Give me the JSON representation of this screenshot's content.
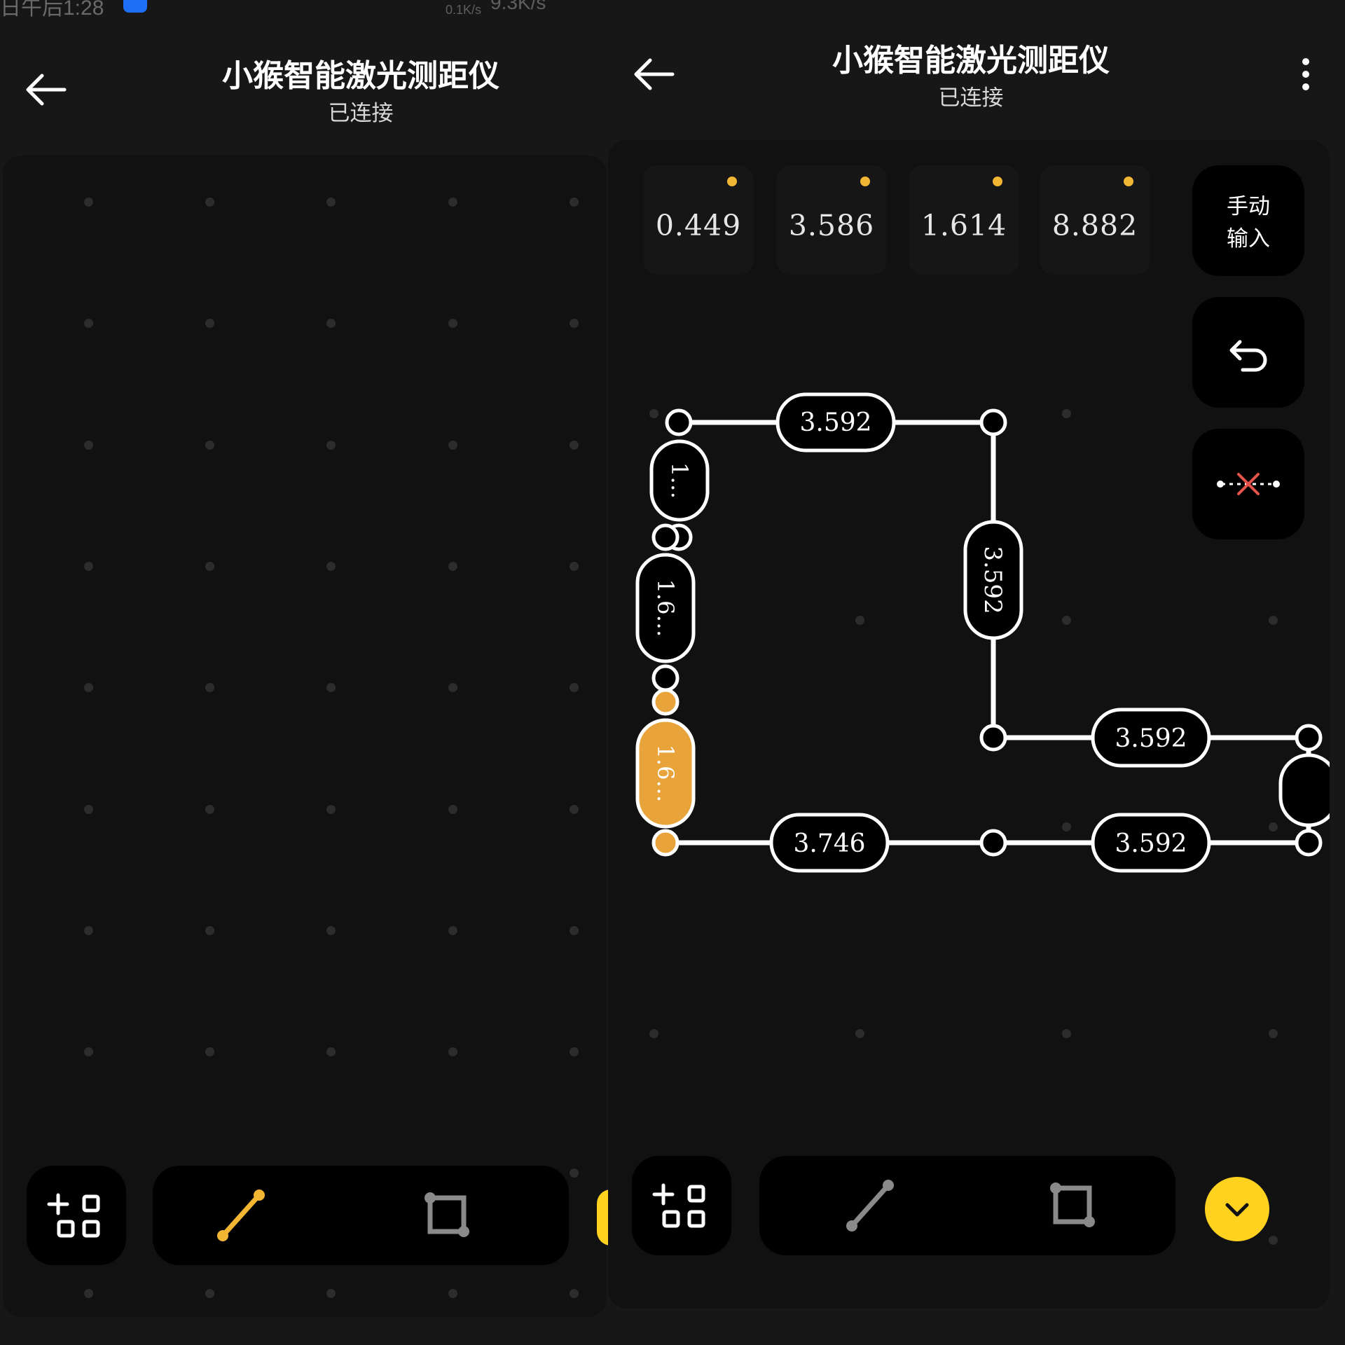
{
  "status_bar": {
    "time_fragment": "日午后1:28",
    "net_small": "0.1K/s",
    "net_speed": "9.3K/s"
  },
  "left_screen": {
    "title": "小猴智能激光测距仪",
    "status": "已连接",
    "icons": {
      "back": "back-arrow-icon",
      "add_grid": "add-grid-icon",
      "line_tool": "line-tool-icon",
      "rect_tool": "rect-tool-icon"
    },
    "colors": {
      "accent": "#F2B632",
      "tool_inactive": "#8A8A8A"
    }
  },
  "right_screen": {
    "title": "小猴智能激光测距仪",
    "status": "已连接",
    "readings": [
      "0.449",
      "3.586",
      "1.614",
      "8.882"
    ],
    "manual_input_label": "手动\n输入",
    "manual_input_line1": "手动",
    "manual_input_line2": "输入",
    "segments": {
      "top": "3.592",
      "right_vertical": "3.592",
      "left_short": "1…",
      "left_mid": "1.6…",
      "left_selected": "1.6…",
      "bottom_left": "3.746",
      "right_upper": "3.592",
      "right_lower": "3.592"
    },
    "icons": {
      "back": "back-arrow-icon",
      "more": "more-vertical-icon",
      "undo": "undo-icon",
      "delete_point": "delete-point-icon",
      "add_grid": "add-grid-icon",
      "line_tool": "line-tool-icon",
      "rect_tool": "rect-tool-icon",
      "expand": "chevron-down-icon"
    },
    "colors": {
      "accent": "#F2B632",
      "fab": "#FFD21F",
      "selected_segment": "#E8A33A"
    }
  }
}
